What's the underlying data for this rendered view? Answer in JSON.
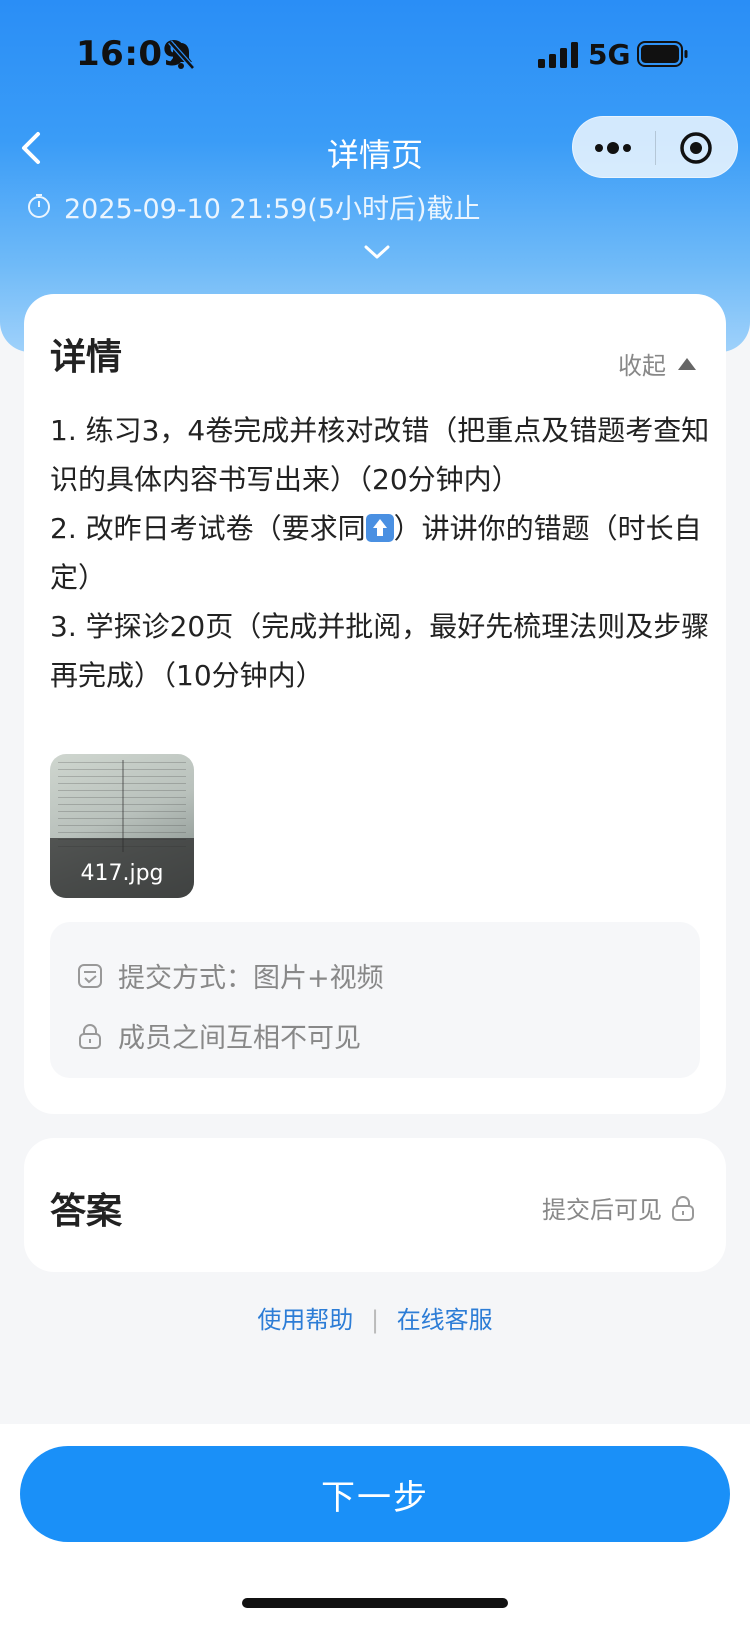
{
  "status_bar": {
    "time": "16:09",
    "network": "5G"
  },
  "nav": {
    "title": "详情页"
  },
  "deadline": {
    "text": "2025-09-10 21:59(5小时后)截止"
  },
  "detail": {
    "title": "详情",
    "collapse_label": "收起",
    "lines": [
      "1. 练习3，4卷完成并核对改错（把重点及错题考查知识的具体内容书写出来）（20分钟内）",
      "2. 改昨日考试卷（要求同",
      "）讲讲你的错题（时长自定）",
      "3. 学探诊20页（完成并批阅，最好先梳理法则及步骤再完成）（10分钟内）"
    ],
    "attachment_name": "417.jpg",
    "submit_method": "提交方式：图片+视频",
    "visibility": "成员之间互相不可见"
  },
  "answer": {
    "title": "答案",
    "visible_after": "提交后可见"
  },
  "help": {
    "help_link": "使用帮助",
    "separator": "|",
    "service_link": "在线客服"
  },
  "footer": {
    "next_label": "下一步"
  },
  "colors": {
    "primary": "#1a90f8",
    "header": "#2a8ef6",
    "link": "#2d7dd6"
  }
}
